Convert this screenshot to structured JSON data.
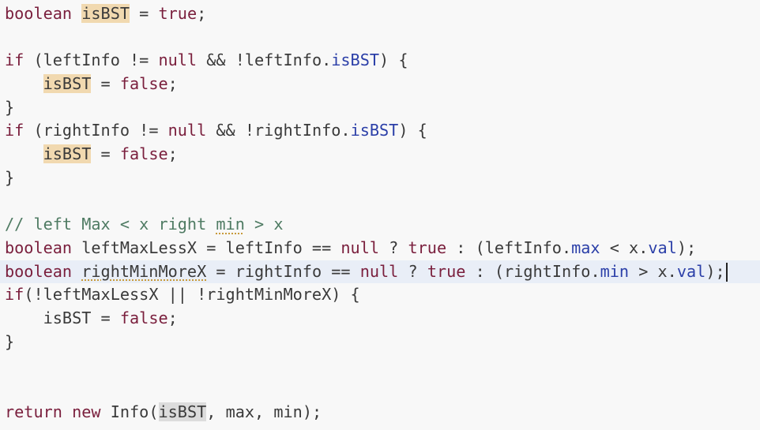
{
  "editor": {
    "lines": [
      {
        "tokens": [
          {
            "t": "boolean",
            "c": "kw"
          },
          {
            "t": " ",
            "c": "id"
          },
          {
            "t": "isBST",
            "c": "id",
            "hl": "occ"
          },
          {
            "t": " = ",
            "c": "id"
          },
          {
            "t": "true",
            "c": "kw"
          },
          {
            "t": ";",
            "c": "id"
          }
        ]
      },
      {
        "tokens": []
      },
      {
        "tokens": [
          {
            "t": "if",
            "c": "kw"
          },
          {
            "t": " (leftInfo != ",
            "c": "id"
          },
          {
            "t": "null",
            "c": "kw"
          },
          {
            "t": " && !leftInfo.",
            "c": "id"
          },
          {
            "t": "isBST",
            "c": "fld"
          },
          {
            "t": ") {",
            "c": "id"
          }
        ]
      },
      {
        "tokens": [
          {
            "t": "    ",
            "c": "id"
          },
          {
            "t": "isBST",
            "c": "id",
            "hl": "occ"
          },
          {
            "t": " = ",
            "c": "id"
          },
          {
            "t": "false",
            "c": "kw"
          },
          {
            "t": ";",
            "c": "id"
          }
        ]
      },
      {
        "tokens": [
          {
            "t": "}",
            "c": "id"
          }
        ]
      },
      {
        "tokens": [
          {
            "t": "if",
            "c": "kw"
          },
          {
            "t": " (rightInfo != ",
            "c": "id"
          },
          {
            "t": "null",
            "c": "kw"
          },
          {
            "t": " && !rightInfo.",
            "c": "id"
          },
          {
            "t": "isBST",
            "c": "fld"
          },
          {
            "t": ") {",
            "c": "id"
          }
        ]
      },
      {
        "tokens": [
          {
            "t": "    ",
            "c": "id"
          },
          {
            "t": "isBST",
            "c": "id",
            "hl": "occ"
          },
          {
            "t": " = ",
            "c": "id"
          },
          {
            "t": "false",
            "c": "kw"
          },
          {
            "t": ";",
            "c": "id"
          }
        ]
      },
      {
        "tokens": [
          {
            "t": "}",
            "c": "id"
          }
        ]
      },
      {
        "tokens": []
      },
      {
        "tokens": [
          {
            "t": "// left Max < x right ",
            "c": "cmt"
          },
          {
            "t": "min",
            "c": "cmt",
            "typo": true
          },
          {
            "t": " > x",
            "c": "cmt"
          }
        ]
      },
      {
        "tokens": [
          {
            "t": "boolean",
            "c": "kw"
          },
          {
            "t": " leftMaxLessX = leftInfo == ",
            "c": "id"
          },
          {
            "t": "null",
            "c": "kw"
          },
          {
            "t": " ? ",
            "c": "id"
          },
          {
            "t": "true",
            "c": "kw"
          },
          {
            "t": " : (leftInfo.",
            "c": "id"
          },
          {
            "t": "max",
            "c": "fld"
          },
          {
            "t": " < x.",
            "c": "id"
          },
          {
            "t": "val",
            "c": "fld"
          },
          {
            "t": ");",
            "c": "id"
          }
        ]
      },
      {
        "current": true,
        "caret": true,
        "tokens": [
          {
            "t": "boolean",
            "c": "kw"
          },
          {
            "t": " ",
            "c": "id"
          },
          {
            "t": "rightMinMoreX",
            "c": "id",
            "typo": true
          },
          {
            "t": " = rightInfo == ",
            "c": "id"
          },
          {
            "t": "null",
            "c": "kw"
          },
          {
            "t": " ? ",
            "c": "id"
          },
          {
            "t": "true",
            "c": "kw"
          },
          {
            "t": " : (rightInfo.",
            "c": "id"
          },
          {
            "t": "min",
            "c": "fld"
          },
          {
            "t": " > x.",
            "c": "id"
          },
          {
            "t": "val",
            "c": "fld"
          },
          {
            "t": ");",
            "c": "id"
          }
        ]
      },
      {
        "tokens": [
          {
            "t": "if",
            "c": "kw"
          },
          {
            "t": "(!leftMaxLessX || !rightMinMoreX) {",
            "c": "id"
          }
        ]
      },
      {
        "tokens": [
          {
            "t": "    isBST = ",
            "c": "id"
          },
          {
            "t": "false",
            "c": "kw"
          },
          {
            "t": ";",
            "c": "id"
          }
        ]
      },
      {
        "tokens": [
          {
            "t": "}",
            "c": "id"
          }
        ]
      },
      {
        "tokens": []
      },
      {
        "tokens": []
      },
      {
        "tokens": [
          {
            "t": "return",
            "c": "kw"
          },
          {
            "t": " ",
            "c": "id"
          },
          {
            "t": "new",
            "c": "kw"
          },
          {
            "t": " Info(",
            "c": "id"
          },
          {
            "t": "isBST",
            "c": "id",
            "hl": "sel"
          },
          {
            "t": ", max, min);",
            "c": "id"
          }
        ]
      }
    ]
  }
}
